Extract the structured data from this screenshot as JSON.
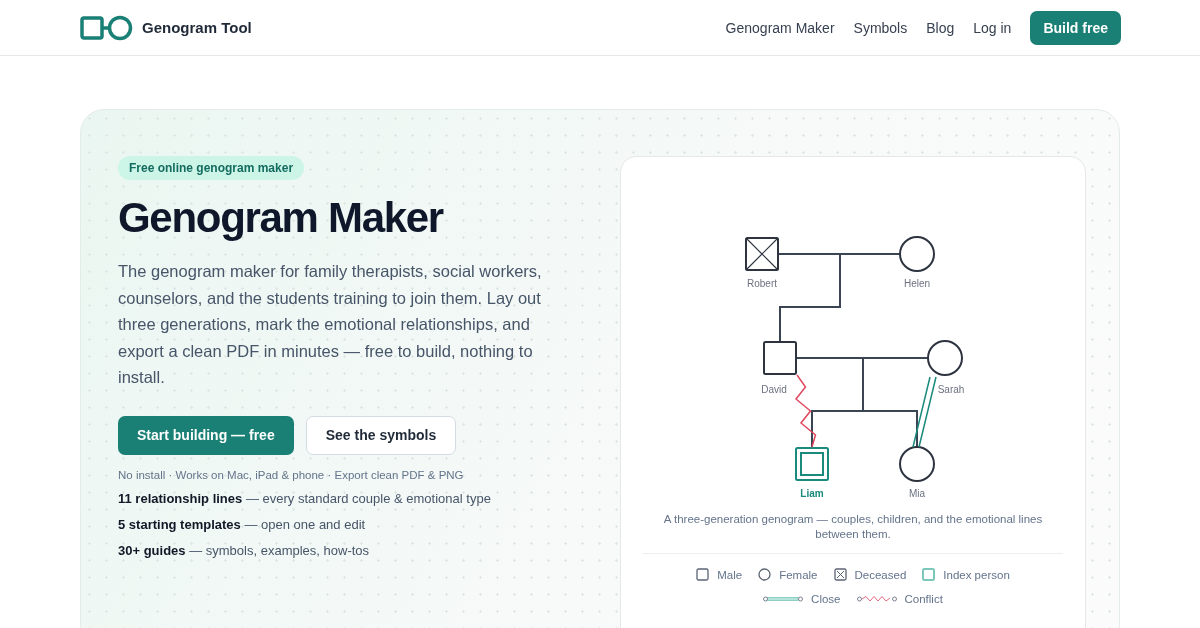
{
  "header": {
    "brand": "Genogram Tool",
    "nav": [
      {
        "label": "Genogram Maker"
      },
      {
        "label": "Symbols"
      },
      {
        "label": "Blog"
      },
      {
        "label": "Log in"
      }
    ],
    "cta": "Build free"
  },
  "hero": {
    "badge": "Free online genogram maker",
    "title": "Genogram Maker",
    "lead": "The genogram maker for family therapists, social workers, counselors, and the students training to join them. Lay out three generations, mark the emotional relationships, and export a clean PDF in minutes — free to build, nothing to install.",
    "buttons": [
      {
        "label": "Start building — free",
        "kind": "primary"
      },
      {
        "label": "See the symbols",
        "kind": "secondary"
      }
    ],
    "note": "No install · Works on Mac, iPad & phone · Export clean PDF & PNG",
    "facts": [
      "**11 relationship lines** — every standard couple & emotional type",
      "**5 starting templates** — open one and edit",
      "**30+ guides** — symbols, examples, how-tos"
    ]
  },
  "diagram": {
    "people": [
      {
        "name": "Robert",
        "kind": "male",
        "deceased": true,
        "index": false
      },
      {
        "name": "Helen",
        "kind": "female",
        "deceased": false,
        "index": false
      },
      {
        "name": "David",
        "kind": "male",
        "deceased": false,
        "index": false
      },
      {
        "name": "Sarah",
        "kind": "female",
        "deceased": false,
        "index": false
      },
      {
        "name": "Liam",
        "kind": "male",
        "deceased": false,
        "index": true
      },
      {
        "name": "Mia",
        "kind": "female",
        "deceased": false,
        "index": false
      }
    ],
    "relations": [
      {
        "kind": "conflict"
      },
      {
        "kind": "close"
      }
    ],
    "caption": "A three-generation genogram — couples, children, and the emotional lines between them.",
    "legend": [
      {
        "label": "Male",
        "kind": "male"
      },
      {
        "label": "Female",
        "kind": "female"
      },
      {
        "label": "Deceased",
        "kind": "deceased"
      },
      {
        "label": "Index person",
        "kind": "index"
      }
    ],
    "line_legend": [
      {
        "label": "Close",
        "kind": "close"
      },
      {
        "label": "Conflict",
        "kind": "conflict"
      }
    ]
  }
}
